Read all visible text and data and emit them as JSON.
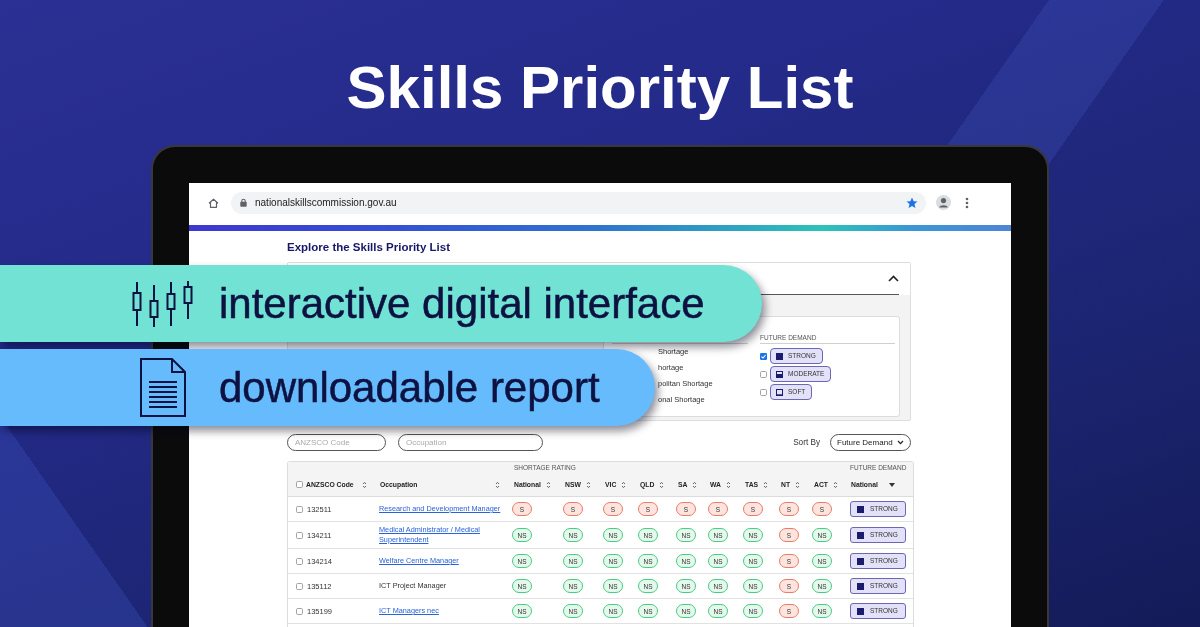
{
  "title": "Skills Priority List",
  "browser": {
    "url": "nationalskillscommission.gov.au",
    "bookmarked": true
  },
  "site": {
    "heading": "Explore the Skills Priority List",
    "filter_panel": {
      "expanded": true,
      "shortage_legend": [
        "Shortage",
        "hortage",
        "politan Shortage",
        "onal Shortage"
      ],
      "future_demand": {
        "heading": "FUTURE DEMAND",
        "options": [
          {
            "label": "STRONG",
            "kind": "strong",
            "checked": true
          },
          {
            "label": "MODERATE",
            "kind": "moderate",
            "checked": false
          },
          {
            "label": "SOFT",
            "kind": "soft",
            "checked": false
          }
        ]
      }
    },
    "search": {
      "code_field": {
        "placeholder": "ANZSCO Code"
      },
      "occupation_field": {
        "placeholder": "Occupation"
      },
      "sort_label": "Sort By",
      "sort_select": {
        "value": "Future Demand"
      }
    },
    "table": {
      "select_all": {
        "checked": false
      },
      "group_headings": [
        "SHORTAGE RATING",
        "FUTURE DEMAND"
      ],
      "columns": [
        {
          "label": "ANZSCO Code",
          "sorted": false
        },
        {
          "label": "Occupation",
          "sorted": false
        },
        {
          "label": "National",
          "sorted": false
        },
        {
          "label": "NSW",
          "sorted": false
        },
        {
          "label": "VIC",
          "sorted": false
        },
        {
          "label": "QLD",
          "sorted": false
        },
        {
          "label": "SA",
          "sorted": false
        },
        {
          "label": "WA",
          "sorted": false
        },
        {
          "label": "TAS",
          "sorted": false
        },
        {
          "label": "NT",
          "sorted": false
        },
        {
          "label": "ACT",
          "sorted": false
        },
        {
          "label": "National",
          "sorted": true
        }
      ],
      "rows": [
        {
          "checked": false,
          "code": "132511",
          "occupation": {
            "text": "Research and Development Manager",
            "kind": "link"
          },
          "ratings": [
            {
              "label": "S",
              "kind": "shortage"
            },
            {
              "label": "S",
              "kind": "shortage"
            },
            {
              "label": "S",
              "kind": "shortage"
            },
            {
              "label": "S",
              "kind": "shortage"
            },
            {
              "label": "S",
              "kind": "shortage"
            },
            {
              "label": "S",
              "kind": "shortage"
            },
            {
              "label": "S",
              "kind": "shortage"
            },
            {
              "label": "S",
              "kind": "shortage"
            },
            {
              "label": "S",
              "kind": "shortage"
            }
          ],
          "future_demand": {
            "label": "STRONG",
            "kind": "strong"
          }
        },
        {
          "checked": false,
          "code": "134211",
          "occupation": {
            "text": "Medical Administrator / Medical Superintendent",
            "kind": "link"
          },
          "ratings": [
            {
              "label": "NS",
              "kind": "no_shortage"
            },
            {
              "label": "NS",
              "kind": "no_shortage"
            },
            {
              "label": "NS",
              "kind": "no_shortage"
            },
            {
              "label": "NS",
              "kind": "no_shortage"
            },
            {
              "label": "NS",
              "kind": "no_shortage"
            },
            {
              "label": "NS",
              "kind": "no_shortage"
            },
            {
              "label": "NS",
              "kind": "no_shortage"
            },
            {
              "label": "S",
              "kind": "shortage"
            },
            {
              "label": "NS",
              "kind": "no_shortage"
            }
          ],
          "future_demand": {
            "label": "STRONG",
            "kind": "strong"
          }
        },
        {
          "checked": false,
          "code": "134214",
          "occupation": {
            "text": "Welfare Centre Manager",
            "kind": "link"
          },
          "ratings": [
            {
              "label": "NS",
              "kind": "no_shortage"
            },
            {
              "label": "NS",
              "kind": "no_shortage"
            },
            {
              "label": "NS",
              "kind": "no_shortage"
            },
            {
              "label": "NS",
              "kind": "no_shortage"
            },
            {
              "label": "NS",
              "kind": "no_shortage"
            },
            {
              "label": "NS",
              "kind": "no_shortage"
            },
            {
              "label": "NS",
              "kind": "no_shortage"
            },
            {
              "label": "S",
              "kind": "shortage"
            },
            {
              "label": "NS",
              "kind": "no_shortage"
            }
          ],
          "future_demand": {
            "label": "STRONG",
            "kind": "strong"
          }
        },
        {
          "checked": false,
          "code": "135112",
          "occupation": {
            "text": "ICT Project Manager",
            "kind": "text"
          },
          "ratings": [
            {
              "label": "NS",
              "kind": "no_shortage"
            },
            {
              "label": "NS",
              "kind": "no_shortage"
            },
            {
              "label": "NS",
              "kind": "no_shortage"
            },
            {
              "label": "NS",
              "kind": "no_shortage"
            },
            {
              "label": "NS",
              "kind": "no_shortage"
            },
            {
              "label": "NS",
              "kind": "no_shortage"
            },
            {
              "label": "NS",
              "kind": "no_shortage"
            },
            {
              "label": "S",
              "kind": "shortage"
            },
            {
              "label": "NS",
              "kind": "no_shortage"
            }
          ],
          "future_demand": {
            "label": "STRONG",
            "kind": "strong"
          }
        },
        {
          "checked": false,
          "code": "135199",
          "occupation": {
            "text": "ICT Managers nec",
            "kind": "link"
          },
          "ratings": [
            {
              "label": "NS",
              "kind": "no_shortage"
            },
            {
              "label": "NS",
              "kind": "no_shortage"
            },
            {
              "label": "NS",
              "kind": "no_shortage"
            },
            {
              "label": "NS",
              "kind": "no_shortage"
            },
            {
              "label": "NS",
              "kind": "no_shortage"
            },
            {
              "label": "NS",
              "kind": "no_shortage"
            },
            {
              "label": "NS",
              "kind": "no_shortage"
            },
            {
              "label": "S",
              "kind": "shortage"
            },
            {
              "label": "NS",
              "kind": "no_shortage"
            }
          ],
          "future_demand": {
            "label": "STRONG",
            "kind": "strong"
          }
        }
      ]
    }
  },
  "banners": [
    {
      "kind": "chart",
      "text": "interactive digital interface"
    },
    {
      "kind": "document",
      "text": "downloadable report"
    }
  ]
}
